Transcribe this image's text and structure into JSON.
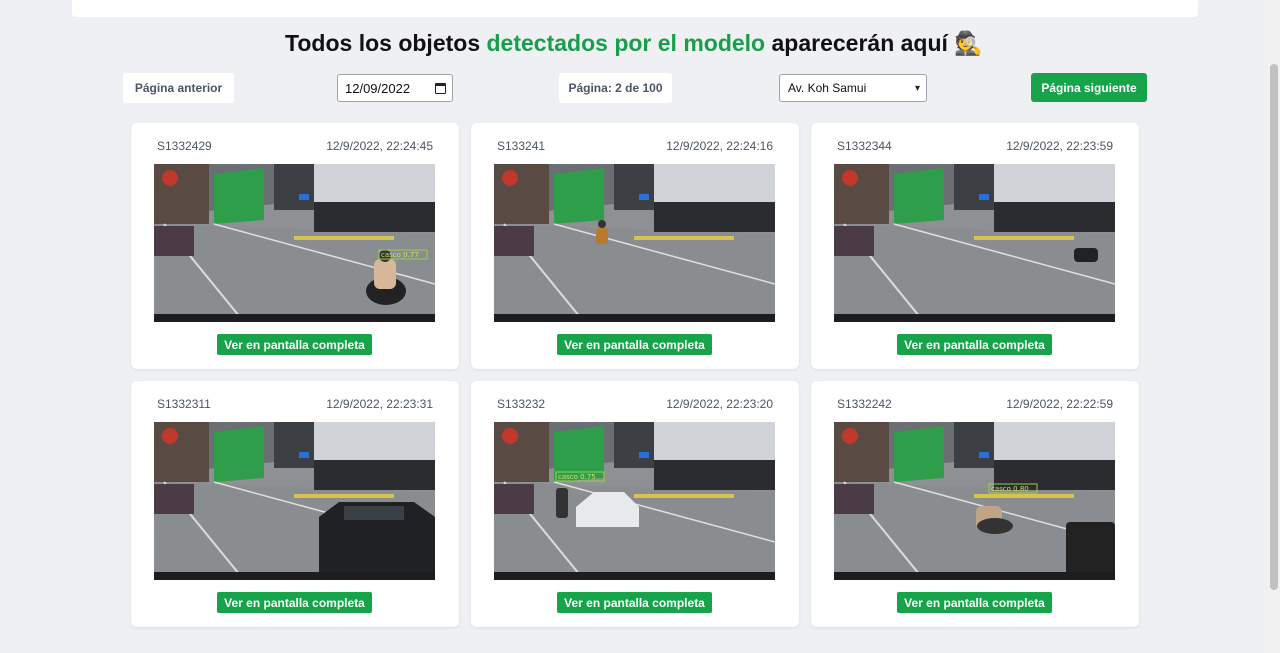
{
  "header": {
    "title_part1": "Todos los objetos ",
    "title_highlight": "detectados por el modelo",
    "title_part2": " aparecerán aquí",
    "title_emoji": "🕵"
  },
  "controls": {
    "prev_label": "Página anterior",
    "date_value": "12/09/2022",
    "page_indicator": "Página: 2 de 100",
    "location_selected": "Av. Koh Samui",
    "next_label": "Página siguiente"
  },
  "colors": {
    "accent": "#16a34a",
    "highlight_text": "#1b9e4b",
    "background": "#eef0f3"
  },
  "detections": [
    {
      "id": "S1332429",
      "timestamp": "12/9/2022, 22:24:45",
      "button_label": "Ver en pantalla completa",
      "label": "casco 0.77"
    },
    {
      "id": "S133241",
      "timestamp": "12/9/2022, 22:24:16",
      "button_label": "Ver en pantalla completa",
      "label": ""
    },
    {
      "id": "S1332344",
      "timestamp": "12/9/2022, 22:23:59",
      "button_label": "Ver en pantalla completa",
      "label": ""
    },
    {
      "id": "S1332311",
      "timestamp": "12/9/2022, 22:23:31",
      "button_label": "Ver en pantalla completa",
      "label": ""
    },
    {
      "id": "S133232",
      "timestamp": "12/9/2022, 22:23:20",
      "button_label": "Ver en pantalla completa",
      "label": "casco 0.75"
    },
    {
      "id": "S1332242",
      "timestamp": "12/9/2022, 22:22:59",
      "button_label": "Ver en pantalla completa",
      "label": "casco 0.80"
    }
  ]
}
